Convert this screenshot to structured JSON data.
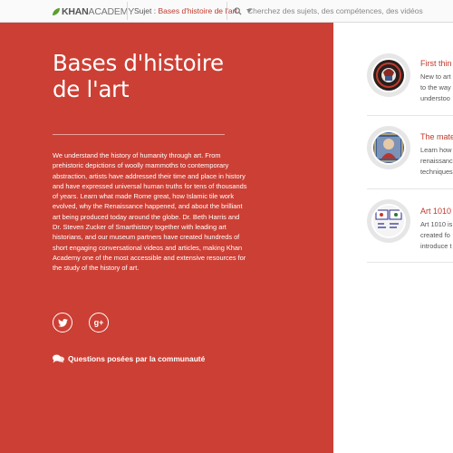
{
  "header": {
    "logo_bold": "KHAN",
    "logo_light": "ACADEMY",
    "subject_label": "Sujet :",
    "subject_value": "Bases d'histoire de l'art",
    "search_placeholder": "Cherchez des sujets, des compétences, des vidéos"
  },
  "hero": {
    "title": "Bases d'histoire de l'art",
    "description": "We understand the history of humanity through art. From prehistoric depictions of woolly mammoths to contemporary abstraction, artists have addressed their time and place in history and have expressed universal human truths for tens of thousands of years. Learn what made Rome great, how Islamic tile work evolved, why the Renaissance happened, and about the brilliant art being produced today around the globe. Dr. Beth Harris and Dr. Steven Zucker of Smarthistory together with leading art historians, and our museum partners have created hundreds of short engaging conversational videos and articles, making Khan Academy one of the most accessible and extensive resources for the study of the history of art.",
    "twitter_icon": "t",
    "gplus_icon": "g+",
    "community_label": "Questions posées par la communauté",
    "accent": "#cc3f34"
  },
  "cards": [
    {
      "title": "First thin",
      "lines": [
        "New to art",
        "to the way",
        "understoo"
      ]
    },
    {
      "title": "The mate",
      "lines": [
        "Learn how",
        "renaissanc",
        "techniques"
      ]
    },
    {
      "title": "Art 1010",
      "lines": [
        "Art 1010 is",
        "created fo",
        "introduce t"
      ]
    }
  ]
}
